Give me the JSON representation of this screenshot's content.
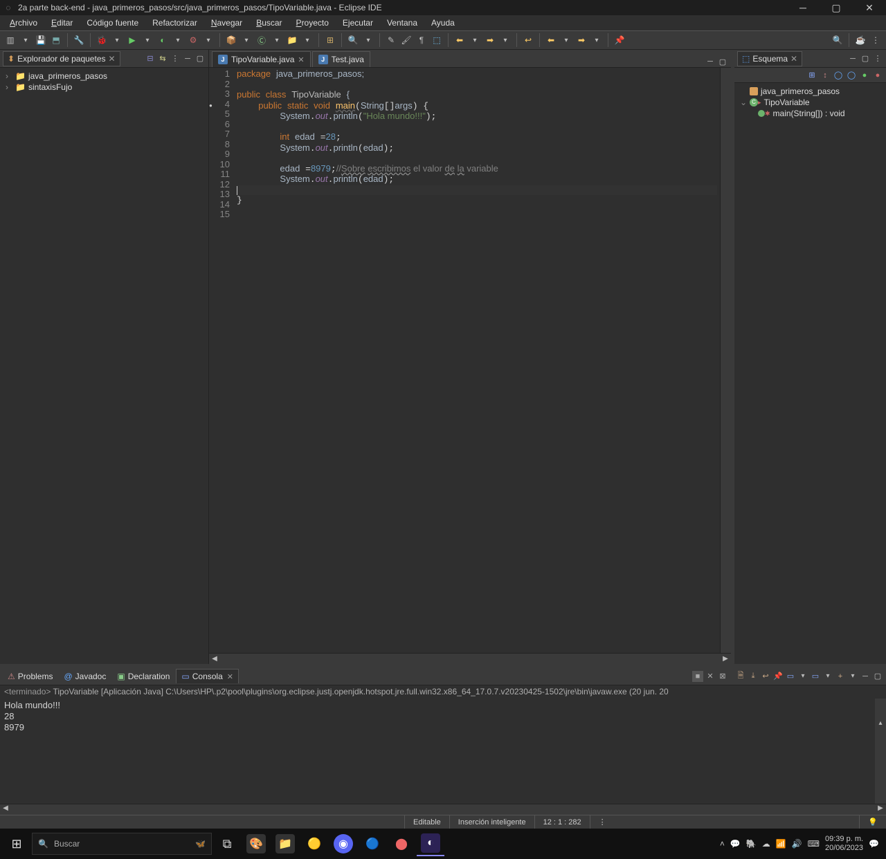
{
  "window": {
    "title": "2a parte back-end - java_primeros_pasos/src/java_primeros_pasos/TipoVariable.java - Eclipse IDE"
  },
  "menu": [
    "Archivo",
    "Editar",
    "Código fuente",
    "Refactorizar",
    "Navegar",
    "Buscar",
    "Proyecto",
    "Ejecutar",
    "Ventana",
    "Ayuda"
  ],
  "menu_underline_idx": [
    0,
    0,
    -1,
    -1,
    0,
    0,
    0,
    -1,
    -1,
    -1
  ],
  "explorer": {
    "title": "Explorador de paquetes",
    "items": [
      {
        "label": "java_primeros_pasos"
      },
      {
        "label": "sintaxisFujo"
      }
    ]
  },
  "editor": {
    "tabs": [
      {
        "label": "TipoVariable.java",
        "active": true
      },
      {
        "label": "Test.java",
        "active": false
      }
    ],
    "line_count": 15,
    "marker_line": 4,
    "code_tokens": {
      "l1": {
        "package": "package",
        "pkg": "java_primeros_pasos"
      },
      "l3": {
        "public": "public",
        "class": "class",
        "name": "TipoVariable"
      },
      "l4": {
        "public": "public",
        "static": "static",
        "void": "void",
        "main": "main",
        "String": "String",
        "args": "args"
      },
      "l5": {
        "System": "System",
        "out": "out",
        "println": "println",
        "hola": "\"Hola mundo!!!\""
      },
      "l7": {
        "int": "int",
        "edad": "edad",
        "val": "28"
      },
      "l8": {
        "System": "System",
        "out": "out",
        "println": "println",
        "edad": "edad"
      },
      "l10": {
        "edad": "edad",
        "val": "8979",
        "comment1": "//",
        "sobre": "Sobre",
        "escribimos": "escribimos",
        "rest": " el valor ",
        "de": "de",
        "la": "la",
        "end": " variable"
      },
      "l11": {
        "System": "System",
        "out": "out",
        "println": "println",
        "edad": "edad"
      }
    }
  },
  "outline": {
    "title": "Esquema",
    "items": {
      "pkg": "java_primeros_pasos",
      "class": "TipoVariable",
      "method": "main(String[]) : void"
    }
  },
  "bottom": {
    "tabs": [
      {
        "label": "Problems",
        "icon": "⚠"
      },
      {
        "label": "Javadoc",
        "icon": "@"
      },
      {
        "label": "Declaration",
        "icon": "📄"
      },
      {
        "label": "Consola",
        "icon": "▭",
        "active": true
      }
    ],
    "console_header_prefix": "<terminado> ",
    "console_header": "TipoVariable [Aplicación Java] C:\\Users\\HP\\.p2\\pool\\plugins\\org.eclipse.justj.openjdk.hotspot.jre.full.win32.x86_64_17.0.7.v20230425-1502\\jre\\bin\\javaw.exe  (20 jun. 20",
    "console_output": "Hola mundo!!!\n28\n8979"
  },
  "status": {
    "editable": "Editable",
    "insert": "Inserción inteligente",
    "pos": "12 : 1 : 282"
  },
  "taskbar": {
    "search_placeholder": "Buscar",
    "time": "09:39 p. m.",
    "date": "20/06/2023"
  }
}
